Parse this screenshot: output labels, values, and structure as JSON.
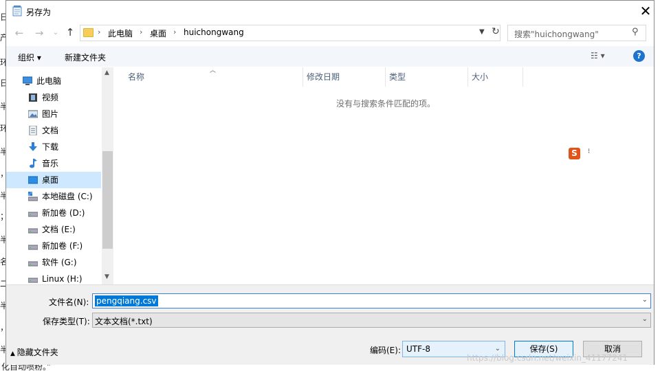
{
  "window": {
    "title": "另存为",
    "close_label": "✕"
  },
  "background": {
    "left_chars": [
      "日",
      "产",
      "环",
      "日",
      "半",
      "环",
      "半",
      "，",
      "半",
      "；",
      "半",
      "名",
      "二",
      "半",
      "，",
      "半",
      "；",
      "半"
    ],
    "bottom_text": "化自动喷粉。”"
  },
  "address_bar": {
    "crumbs": [
      "此电脑",
      "桌面",
      "huichongwang"
    ],
    "separator": "›"
  },
  "search": {
    "placeholder": "搜索\"huichongwang\""
  },
  "toolbar": {
    "organize_label": "组织 ▾",
    "new_folder_label": "新建文件夹",
    "help_label": "?"
  },
  "nav_pane": {
    "items": [
      {
        "label": "此电脑",
        "icon": "computer-icon",
        "selected": false
      },
      {
        "label": "视频",
        "icon": "video-icon",
        "selected": false
      },
      {
        "label": "图片",
        "icon": "picture-icon",
        "selected": false
      },
      {
        "label": "文档",
        "icon": "document-icon",
        "selected": false
      },
      {
        "label": "下载",
        "icon": "download-icon",
        "selected": false
      },
      {
        "label": "音乐",
        "icon": "music-icon",
        "selected": false
      },
      {
        "label": "桌面",
        "icon": "desktop-icon",
        "selected": true
      },
      {
        "label": "本地磁盘 (C:)",
        "icon": "drive-icon",
        "selected": false
      },
      {
        "label": "新加卷 (D:)",
        "icon": "drive-icon",
        "selected": false
      },
      {
        "label": "文档 (E:)",
        "icon": "drive-icon",
        "selected": false
      },
      {
        "label": "新加卷 (F:)",
        "icon": "drive-icon",
        "selected": false
      },
      {
        "label": "软件 (G:)",
        "icon": "drive-icon",
        "selected": false
      },
      {
        "label": "Linux (H:)",
        "icon": "drive-icon",
        "selected": false
      }
    ]
  },
  "file_list": {
    "columns": [
      "名称",
      "修改日期",
      "类型",
      "大小"
    ],
    "empty_message": "没有与搜索条件匹配的项。"
  },
  "ime": {
    "logo": "S",
    "dots": "•\n•"
  },
  "form": {
    "filename_label": "文件名(N):",
    "filename_value": "pengqiang.csv",
    "filetype_label": "保存类型(T):",
    "filetype_value": "文本文档(*.txt)",
    "hide_folders_label": "隐藏文件夹",
    "encoding_label": "编码(E):",
    "encoding_value": "UTF-8",
    "save_label": "保存(S)",
    "cancel_label": "取消"
  },
  "watermark": "https://blog.csdn.net/weixin_41177241",
  "colors": {
    "accent": "#0078d7",
    "selection_bg": "#cde8ff",
    "help_icon": "#1e73cf"
  }
}
